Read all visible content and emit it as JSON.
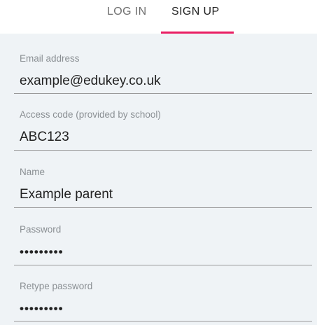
{
  "tabs": {
    "login": "LOG IN",
    "signup": "SIGN UP",
    "active": "signup",
    "accent_color": "#e91e63"
  },
  "form": {
    "background": "#eff3f6",
    "fields": [
      {
        "label": "Email address",
        "value": "example@edukey.co.uk"
      },
      {
        "label": "Access code (provided by school)",
        "value": "ABC123"
      },
      {
        "label": "Name",
        "value": "Example parent"
      },
      {
        "label": "Password",
        "value": "•••••••••"
      },
      {
        "label": "Retype password",
        "value": "•••••••••"
      }
    ]
  }
}
